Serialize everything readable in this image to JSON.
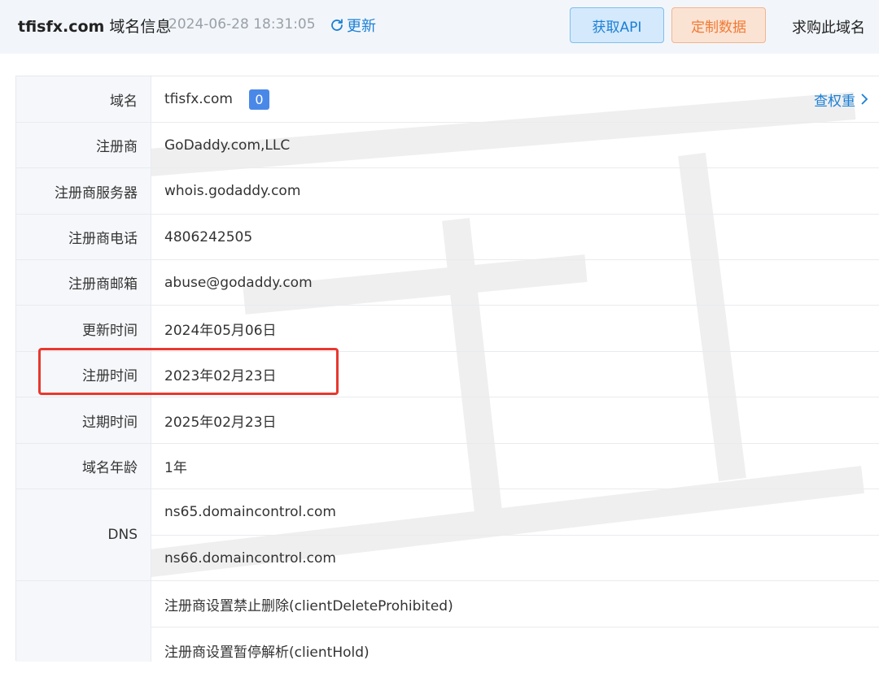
{
  "header": {
    "domain": "tfisfx.com",
    "title_suffix": "域名信息",
    "timestamp": "2024-06-28 18:31:05",
    "refresh_label": "更新",
    "api_button": "获取API",
    "custom_button": "定制数据",
    "buy_link": "求购此域名"
  },
  "colors": {
    "accent": "#1a7fd6",
    "highlight": "#e8382f",
    "label_bg": "#f5f7fa"
  },
  "rows": {
    "domain": {
      "label": "域名",
      "value": "tfisfx.com",
      "badge": "0",
      "link": "查权重"
    },
    "registrar": {
      "label": "注册商",
      "value": "GoDaddy.com,LLC"
    },
    "server": {
      "label": "注册商服务器",
      "value": "whois.godaddy.com"
    },
    "phone": {
      "label": "注册商电话",
      "value": "4806242505"
    },
    "email": {
      "label": "注册商邮箱",
      "value": "abuse@godaddy.com"
    },
    "updated": {
      "label": "更新时间",
      "value": "2024年05月06日"
    },
    "registered": {
      "label": "注册时间",
      "value": "2023年02月23日"
    },
    "expires": {
      "label": "过期时间",
      "value": "2025年02月23日"
    },
    "age": {
      "label": "域名年龄",
      "value": "1年"
    },
    "dns": {
      "label": "DNS",
      "values": [
        "ns65.domaincontrol.com",
        "ns66.domaincontrol.com"
      ]
    },
    "status": {
      "values": [
        "注册商设置禁止删除(clientDeleteProhibited)",
        "注册商设置暂停解析(clientHold)"
      ]
    }
  }
}
